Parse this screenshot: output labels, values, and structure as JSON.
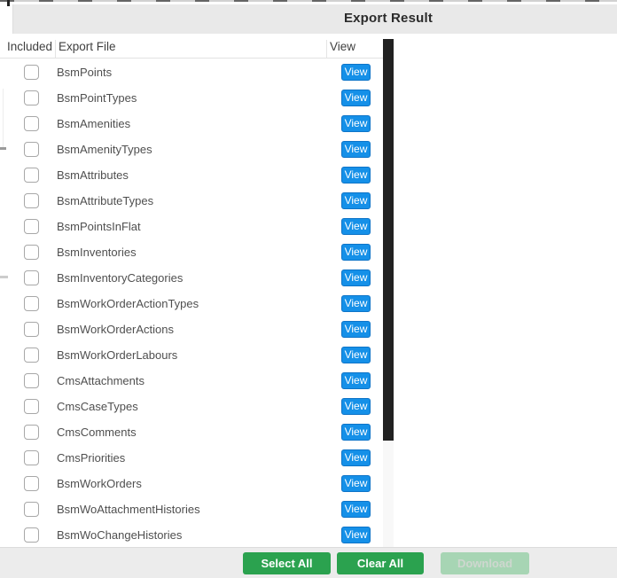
{
  "window": {
    "title": "Export Result"
  },
  "table": {
    "columns": [
      "Included",
      "Export File",
      "View"
    ],
    "view_button_label": "View",
    "checkboxes_checked": false,
    "rows": [
      "BsmPoints",
      "BsmPointTypes",
      "BsmAmenities",
      "BsmAmenityTypes",
      "BsmAttributes",
      "BsmAttributeTypes",
      "BsmPointsInFlat",
      "BsmInventories",
      "BsmInventoryCategories",
      "BsmWorkOrderActionTypes",
      "BsmWorkOrderActions",
      "BsmWorkOrderLabours",
      "CmsAttachments",
      "CmsCaseTypes",
      "CmsComments",
      "CmsPriorities",
      "BsmWorkOrders",
      "BsmWoAttachmentHistories",
      "BsmWoChangeHistories"
    ]
  },
  "scrollbar": {
    "thumb_position": "top"
  },
  "footer": {
    "select_all_label": "Select All",
    "clear_all_label": "Clear All",
    "download_label": "Download",
    "download_enabled": false
  },
  "colors": {
    "view_button": "#1590e8",
    "action_button_green": "#2ba24f",
    "download_disabled_bg": "#a7d5b4",
    "titlebar_bg": "#e9e9e9",
    "footer_bg": "#ececec",
    "scrollbar_thumb": "#212121"
  }
}
